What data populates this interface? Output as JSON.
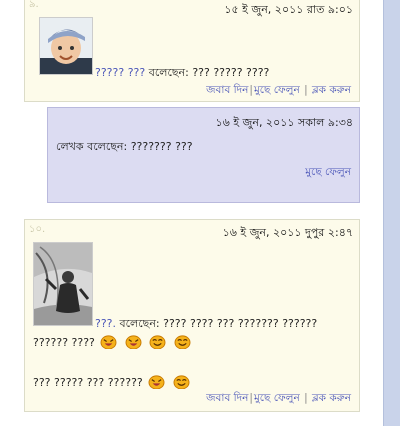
{
  "comments": [
    {
      "number": "৯.",
      "date": "১৫ ই জুন, ২০১১ রাত ৯:০১",
      "author": "????? ???",
      "said": "বলেছেন:",
      "text": "??? ????? ????",
      "actions": {
        "reply": "জবাব দিন",
        "delete": "মুছে ফেলুন",
        "block": "ব্লক করুন"
      }
    },
    {
      "number": "১০.",
      "date": "১৬ ই জুন, ২০১১ দুপুর ২:৪৭",
      "author": "???.",
      "said": "বলেছেন:",
      "line1": "???? ???? ??? ??????? ??????",
      "line2": "?????? ????",
      "line3": "??? ????? ??? ??????",
      "actions": {
        "reply": "জবাব দিন",
        "delete": "মুছে ফেলুন",
        "block": "ব্লক করুন"
      }
    }
  ],
  "reply": {
    "date": "১৬ ই জুন, ২০১১ সকাল ৯:৩৪",
    "author": "লেখক",
    "said": "বলেছেন:",
    "text": "??????? ???",
    "delete": "মুছে ফেলুন"
  },
  "colors": {
    "card_bg": "#fdfbea",
    "reply_bg": "#dcdcf2",
    "link": "#4a55b8",
    "sidebar": "#c9d3ea"
  }
}
